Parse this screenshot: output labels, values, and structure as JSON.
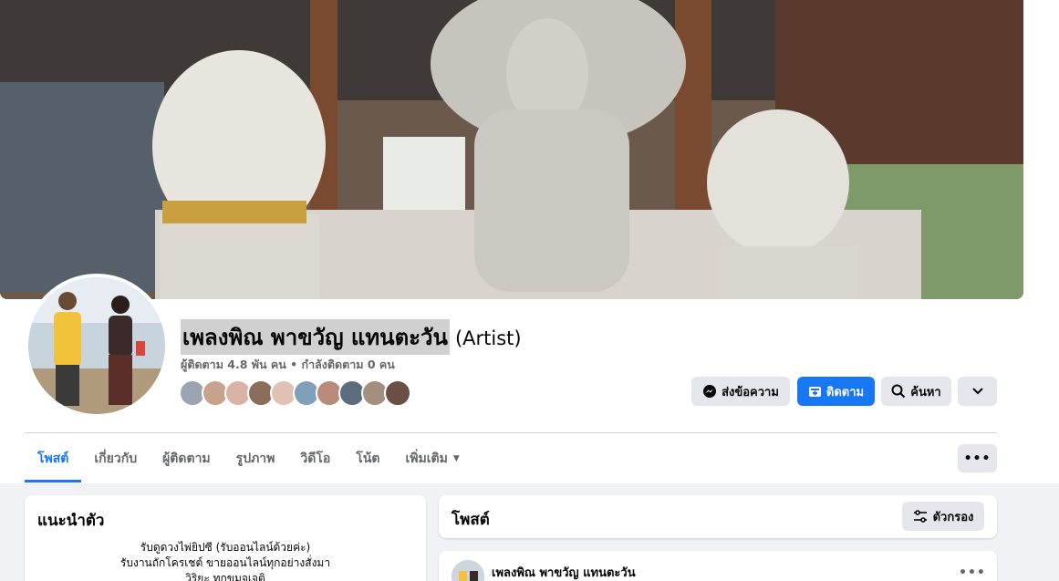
{
  "page": {
    "name": "เพลงพิณ พาขวัญ แทนตะวัน",
    "category": "(Artist)",
    "stats": "ผู้ติดตาม 4.8 พัน คน • กำลังติดตาม 0 คน"
  },
  "friends": [
    "#9aa5b1",
    "#c9a28e",
    "#d9b3a6",
    "#8a6e5a",
    "#e2c1b5",
    "#7fa0b8",
    "#b88a7a",
    "#5d6c7c",
    "#a38f80",
    "#6b4e44"
  ],
  "actions": {
    "message_label": "ส่งข้อความ",
    "follow_label": "ติดตาม",
    "search_label": "ค้นหา"
  },
  "tabs": [
    {
      "label": "โพสต์"
    },
    {
      "label": "เกี่ยวกับ"
    },
    {
      "label": "ผู้ติดตาม"
    },
    {
      "label": "รูปภาพ"
    },
    {
      "label": "วิดีโอ"
    },
    {
      "label": "โน้ต"
    },
    {
      "label": "เพิ่มเติม"
    }
  ],
  "intro": {
    "title": "แนะนำตัว",
    "bio_lines": [
      "รับดูดวงไพ่ยิปซี (รับออนไลน์ด้วยค่ะ)",
      "รับงานถักโครเชต์ ขายออนไลน์ทุกอย่างสั่งมา",
      "วิริยะ ทุกขมจเจติ"
    ]
  },
  "posts": {
    "title": "โพสต์",
    "filter_label": "ตัวกรอง",
    "first_author": "เพลงพิณ พาขวัญ แทนตะวัน"
  },
  "colors": {
    "accent": "#1877f2",
    "button_gray": "#e4e6eb",
    "secondary_text": "#65676b",
    "page_bg": "#f0f2f5"
  }
}
